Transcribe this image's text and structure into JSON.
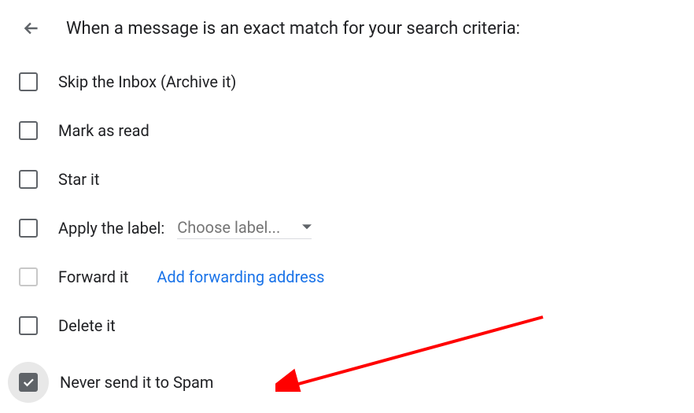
{
  "header": {
    "title": "When a message is an exact match for your search criteria:"
  },
  "options": {
    "skip_inbox": {
      "label": "Skip the Inbox (Archive it)",
      "checked": false
    },
    "mark_read": {
      "label": "Mark as read",
      "checked": false
    },
    "star": {
      "label": "Star it",
      "checked": false
    },
    "apply_label": {
      "label": "Apply the label:",
      "dropdown_placeholder": "Choose label...",
      "checked": false
    },
    "forward": {
      "label": "Forward it",
      "link_text": "Add forwarding address",
      "checked": false
    },
    "delete": {
      "label": "Delete it",
      "checked": false
    },
    "never_spam": {
      "label": "Never send it to Spam",
      "checked": true
    }
  }
}
